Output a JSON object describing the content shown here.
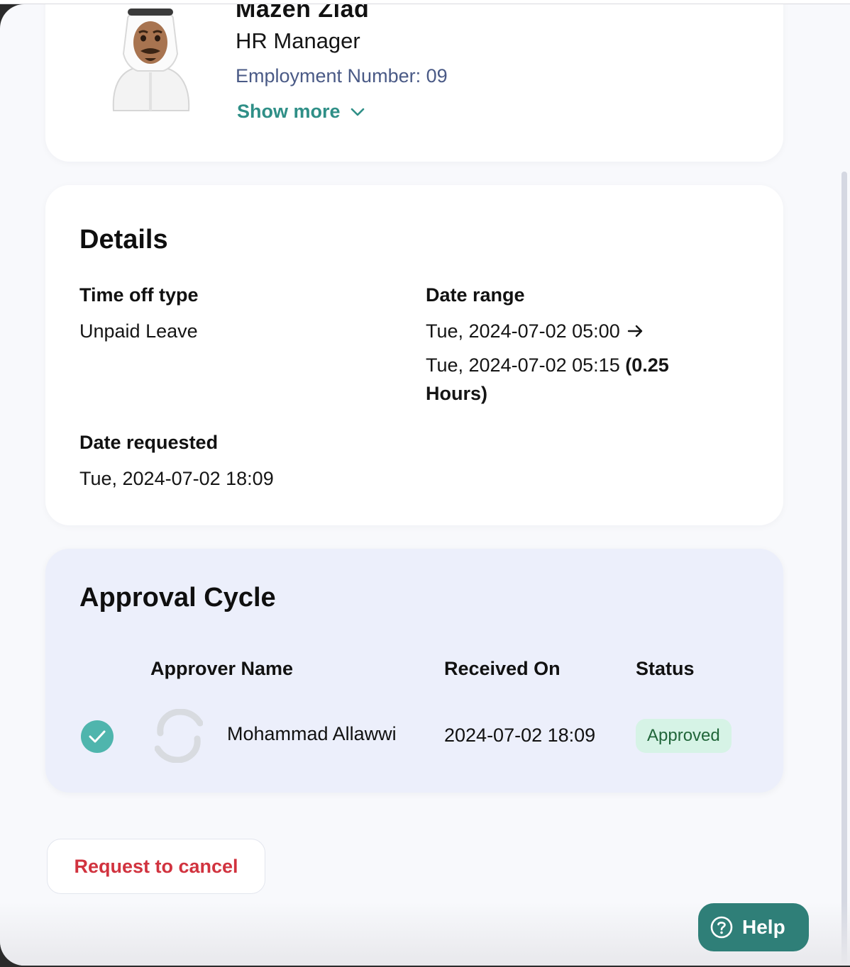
{
  "profile": {
    "name": "Mazen Ziad",
    "role": "HR Manager",
    "employment_number": "Employment Number: 09",
    "show_more": "Show more",
    "avatar_icon": "man-with-ghutra-avatar-icon"
  },
  "details": {
    "title": "Details",
    "time_off_type_label": "Time off type",
    "time_off_type_value": "Unpaid Leave",
    "date_range_label": "Date range",
    "date_range_start": "Tue, 2024-07-02 05:00",
    "date_range_end": "Tue, 2024-07-02 05:15",
    "date_range_duration_1": "(0.25",
    "date_range_duration_2": "Hours)",
    "date_requested_label": "Date requested",
    "date_requested_value": "Tue, 2024-07-02 18:09"
  },
  "approval": {
    "title": "Approval Cycle",
    "columns": {
      "approver_name": "Approver Name",
      "received_on": "Received On",
      "status": "Status"
    },
    "rows": [
      {
        "name": "Mohammad Allawwi",
        "received_on": "2024-07-02 18:09",
        "status": "Approved"
      }
    ]
  },
  "actions": {
    "request_cancel": "Request to cancel",
    "help": "Help"
  },
  "colors": {
    "accent": "#2f8f87",
    "danger": "#d1333f",
    "approved_bg": "#d6f3e6",
    "approved_text": "#21663a",
    "approval_card_bg": "#eceffb",
    "help_bg": "#2f7f78"
  }
}
